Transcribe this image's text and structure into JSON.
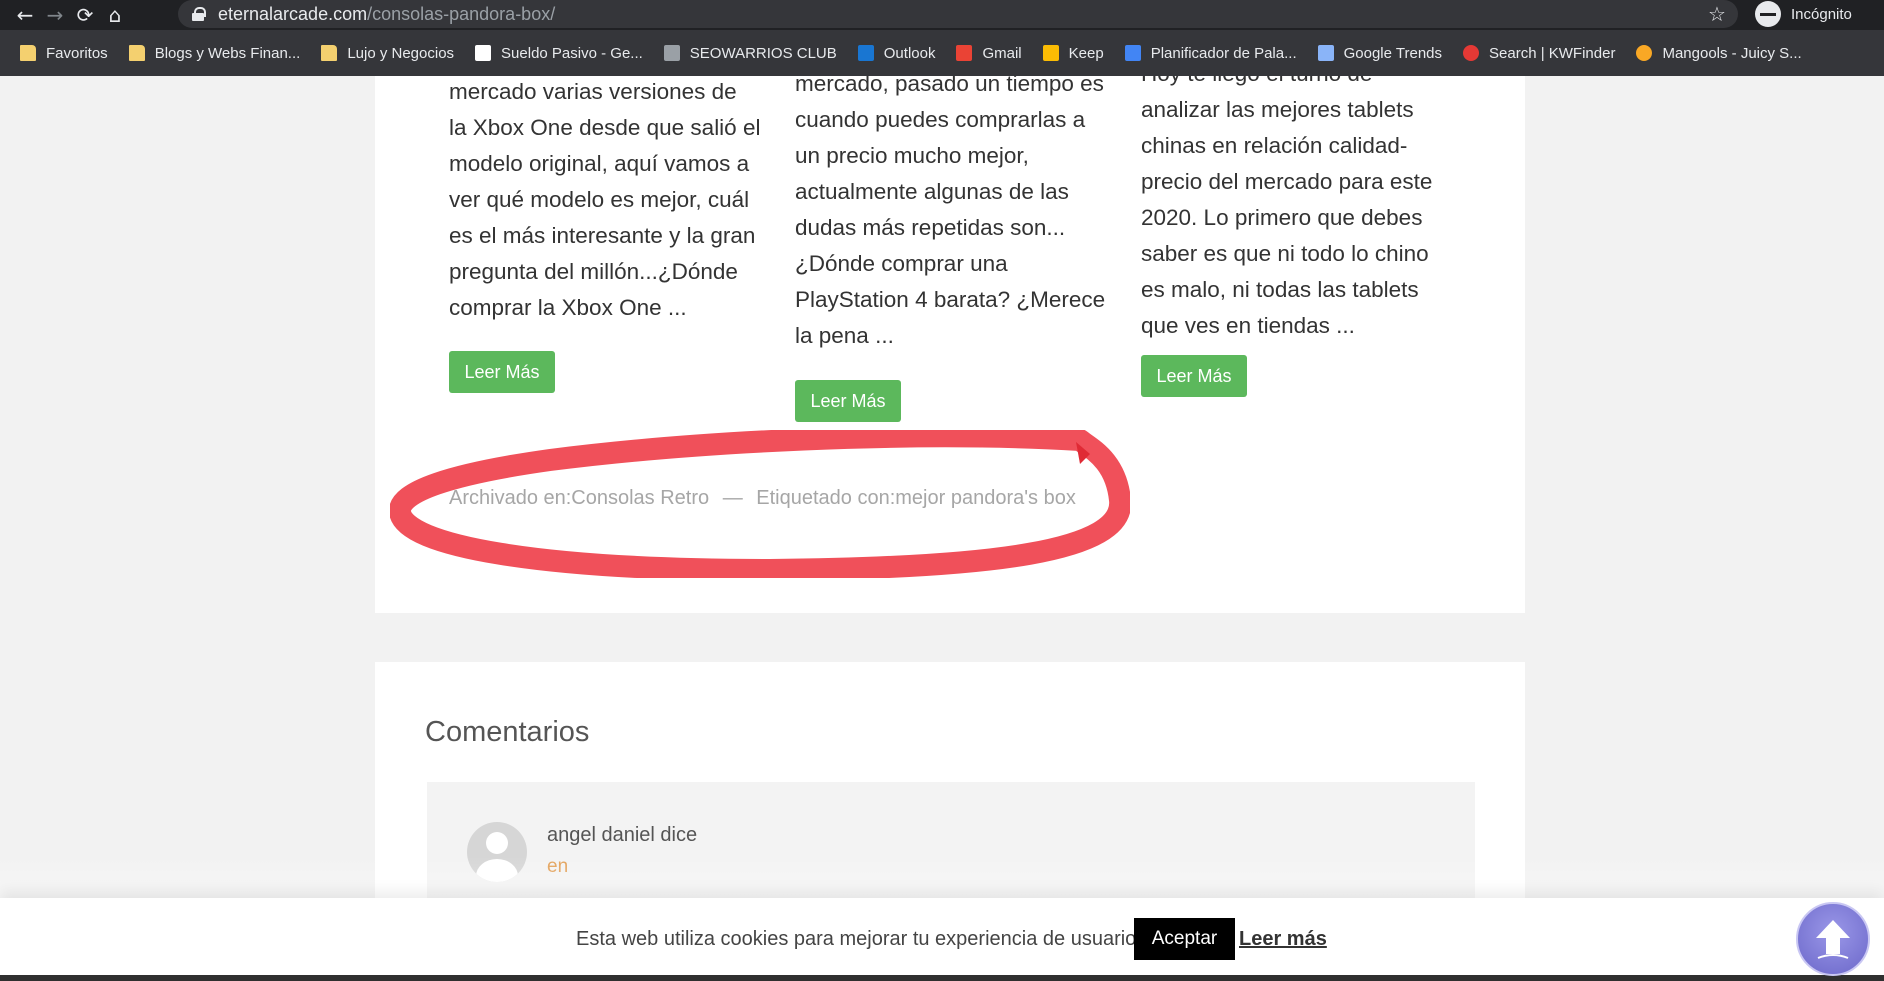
{
  "browser": {
    "url_host": "eternalarcade.com",
    "url_path": "/consolas-pandora-box/",
    "profile_label": "Incógnito",
    "bookmarks": [
      {
        "label": "Favoritos",
        "icon": "folder-icon",
        "color": "#f4d06f"
      },
      {
        "label": "Blogs y Webs Finan...",
        "icon": "folder-icon",
        "color": "#f4d06f"
      },
      {
        "label": "Lujo y Negocios",
        "icon": "folder-icon",
        "color": "#f4d06f"
      },
      {
        "label": "Sueldo Pasivo - Ge...",
        "icon": "site-icon",
        "color": "#ffffff"
      },
      {
        "label": "SEOWARRIOS CLUB",
        "icon": "site-icon",
        "color": "#9aa0a6"
      },
      {
        "label": "Outlook",
        "icon": "outlook-icon",
        "color": "#1976d2"
      },
      {
        "label": "Gmail",
        "icon": "gmail-icon",
        "color": "#ea4335"
      },
      {
        "label": "Keep",
        "icon": "keep-icon",
        "color": "#fbbc04"
      },
      {
        "label": "Planificador de Pala...",
        "icon": "ads-icon",
        "color": "#4285f4"
      },
      {
        "label": "Google Trends",
        "icon": "trends-icon",
        "color": "#8ab4f8"
      },
      {
        "label": "Search | KWFinder",
        "icon": "kwfinder-icon",
        "color": "#e53935"
      },
      {
        "label": "Mangools - Juicy S...",
        "icon": "mangools-icon",
        "color": "#f9a825"
      }
    ]
  },
  "articles": [
    {
      "lines": [
        "mercado varias versiones de",
        "la Xbox One desde que salió el",
        "modelo original, aquí vamos a",
        "ver qué modelo es mejor, cuál",
        "es el más interesante y la gran",
        "pregunta del millón...¿Dónde",
        "comprar la Xbox One ..."
      ],
      "button": "Leer Más"
    },
    {
      "lines": [
        "mercado, pasado un tiempo es",
        "cuando puedes comprarlas a",
        "un precio mucho mejor,",
        "actualmente algunas de las",
        "dudas más repetidas son...",
        "¿Dónde comprar una",
        "PlayStation 4 barata? ¿Merece",
        "la pena ..."
      ],
      "button": "Leer Más"
    },
    {
      "lines": [
        "Hoy te llegó el turno de",
        "analizar las mejores tablets",
        "chinas en relación calidad-",
        "precio del mercado para este",
        "2020. Lo primero que debes",
        "saber es que ni todo lo chino",
        "es malo, ni todas las tablets",
        "que ves en tiendas ..."
      ],
      "button": "Leer Más"
    }
  ],
  "meta": {
    "filed_prefix": "Archivado en:",
    "filed_category": "Consolas Retro",
    "separator": "—",
    "tagged_prefix": "Etiquetado con:",
    "tagged_tag": "mejor pandora's box",
    "highlight_color": "#f0505a"
  },
  "comments": {
    "title": "Comentarios",
    "author": "angel daniel dice",
    "date": "en"
  },
  "cookie_bar": {
    "text": "Esta web utiliza cookies para mejorar tu experiencia de usuario.",
    "accept": "Aceptar",
    "more": "Leer más"
  },
  "colors": {
    "button_green": "#5cb85c",
    "scroll_button": "#7b77d6"
  }
}
